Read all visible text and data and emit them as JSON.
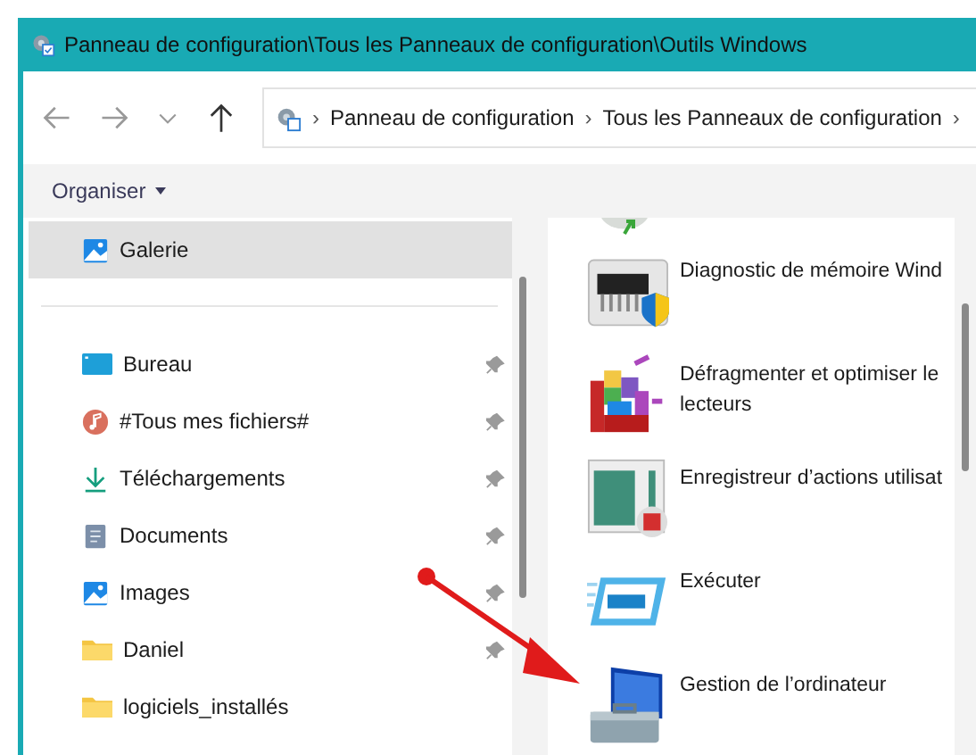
{
  "window": {
    "title": "Panneau de configuration\\Tous les Panneaux de configuration\\Outils Windows"
  },
  "address": {
    "segments": [
      "Panneau de configuration",
      "Tous les Panneaux de configuration"
    ],
    "separator": "›"
  },
  "toolbar": {
    "organiser": "Organiser"
  },
  "sidebar": {
    "items": [
      {
        "label": "Galerie",
        "kind": "gallery",
        "selected": true,
        "pinned": false
      },
      {
        "label": "Bureau",
        "kind": "desktop",
        "selected": false,
        "pinned": true
      },
      {
        "label": "#Tous mes fichiers#",
        "kind": "music",
        "selected": false,
        "pinned": true
      },
      {
        "label": "Téléchargements",
        "kind": "download",
        "selected": false,
        "pinned": true
      },
      {
        "label": "Documents",
        "kind": "document",
        "selected": false,
        "pinned": true
      },
      {
        "label": "Images",
        "kind": "images",
        "selected": false,
        "pinned": true
      },
      {
        "label": "Daniel",
        "kind": "folder",
        "selected": false,
        "pinned": true
      },
      {
        "label": "logiciels_installés",
        "kind": "folder",
        "selected": false,
        "pinned": false
      }
    ]
  },
  "content": {
    "items": [
      {
        "label": "Diagnostic de mémoire Wind",
        "kind": "memory"
      },
      {
        "label": "Défragmenter et optimiser le lecteurs",
        "kind": "defrag"
      },
      {
        "label": "Enregistreur d’actions utilisat",
        "kind": "recorder"
      },
      {
        "label": "Exécuter",
        "kind": "run"
      },
      {
        "label": "Gestion de l’ordinateur",
        "kind": "computer"
      }
    ]
  }
}
